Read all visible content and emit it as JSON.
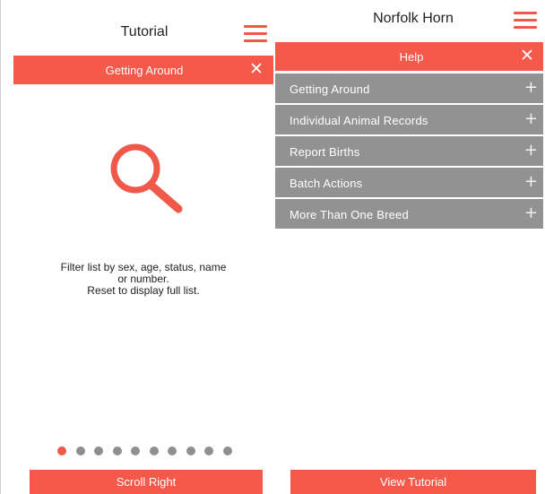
{
  "tutorial_screen": {
    "title": "Tutorial",
    "banner_title": "Getting Around",
    "close_glyph": "✕",
    "icon": "search-icon",
    "description_lines": [
      "Filter list by sex, age, status, name",
      "or number.",
      "Reset to display full list."
    ],
    "page_indicator": {
      "total": 10,
      "current": 1
    },
    "scroll_button_label": "Scroll Right"
  },
  "help_screen": {
    "title": "Norfolk Horn",
    "banner_title": "Help",
    "close_glyph": "✕",
    "sections": [
      {
        "label": "Getting Around",
        "expand_glyph": "+"
      },
      {
        "label": "Individual Animal Records",
        "expand_glyph": "+"
      },
      {
        "label": "Report Births",
        "expand_glyph": "+"
      },
      {
        "label": "Batch Actions",
        "expand_glyph": "+"
      },
      {
        "label": "More Than One Breed",
        "expand_glyph": "+"
      }
    ],
    "tutorial_button_label": "View Tutorial"
  },
  "colors": {
    "accent": "#f5594a",
    "menu_icon": "#f0584a",
    "accordion_bg": "#929292",
    "dot_inactive": "#8f8f8f"
  }
}
